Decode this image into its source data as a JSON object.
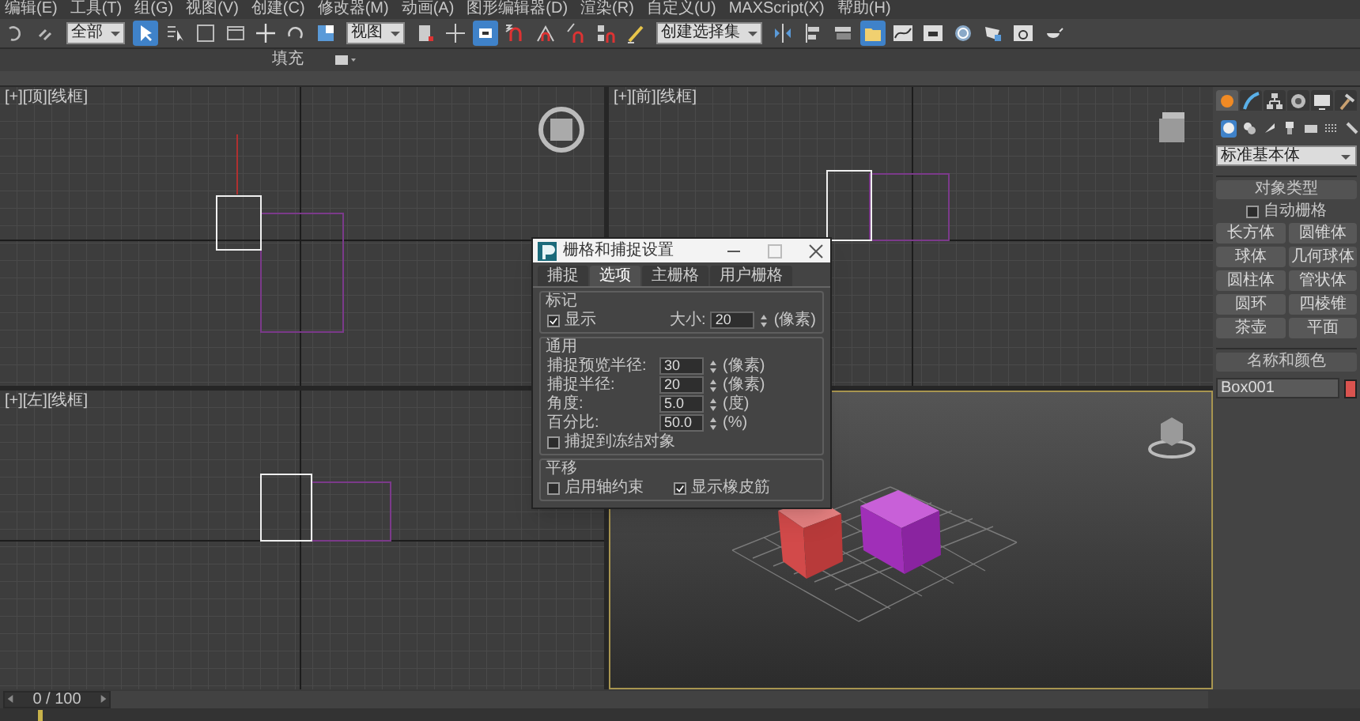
{
  "menu_bar": [
    "编辑(E)",
    "工具(T)",
    "组(G)",
    "视图(V)",
    "创建(C)",
    "修改器(M)",
    "动画(A)",
    "图形编辑器(D)",
    "渲染(R)",
    "自定义(U)",
    "MAXScript(X)",
    "帮助(H)"
  ],
  "toolbar": [
    {
      "kind": "button",
      "selected": false
    },
    {
      "kind": "button",
      "selected": false
    },
    {
      "kind": "dropdown",
      "value": "全部"
    },
    {
      "kind": "button",
      "selected": true
    },
    {
      "kind": "button",
      "selected": false
    },
    {
      "kind": "button",
      "selected": false
    },
    {
      "kind": "button",
      "selected": false
    },
    {
      "kind": "button",
      "selected": false
    },
    {
      "kind": "button",
      "selected": false
    },
    {
      "kind": "button",
      "selected": false
    },
    {
      "kind": "dropdown",
      "value": "视图"
    },
    {
      "kind": "button",
      "selected": false
    },
    {
      "kind": "button",
      "selected": false
    },
    {
      "kind": "button",
      "selected": true
    },
    {
      "kind": "button",
      "selected": false
    },
    {
      "kind": "button",
      "selected": false
    },
    {
      "kind": "button",
      "selected": false
    },
    {
      "kind": "button",
      "selected": false
    },
    {
      "kind": "button",
      "selected": false
    },
    {
      "kind": "dropdown",
      "value": "创建选择集"
    },
    {
      "kind": "button",
      "selected": false
    },
    {
      "kind": "button",
      "selected": false
    },
    {
      "kind": "button",
      "selected": false
    },
    {
      "kind": "button",
      "selected": true
    },
    {
      "kind": "button",
      "selected": false
    },
    {
      "kind": "button",
      "selected": false
    },
    {
      "kind": "button",
      "selected": false
    },
    {
      "kind": "button",
      "selected": false
    },
    {
      "kind": "button",
      "selected": false
    },
    {
      "kind": "button",
      "selected": false
    }
  ],
  "ribbon": {
    "label": "填充"
  },
  "viewports": [
    {
      "label": "[+][顶][线框]",
      "kind": "top"
    },
    {
      "label": "[+][前][线框]",
      "kind": "front"
    },
    {
      "label": "[+][左][线框]",
      "kind": "left"
    },
    {
      "kind": "perspective"
    }
  ],
  "dialog": {
    "title": "栅格和捕捉设置",
    "tabs": [
      {
        "label": "捕捉",
        "selected": false
      },
      {
        "label": "选项",
        "selected": true
      },
      {
        "label": "主栅格",
        "selected": false
      },
      {
        "label": "用户栅格",
        "selected": false
      }
    ],
    "groups": [
      {
        "title": "标记",
        "rows": [
          [
            {
              "kind": "checkbox",
              "label": "显示",
              "checked": true
            },
            {
              "kind": "spinner",
              "label": "大小:",
              "value": "20",
              "unit": "(像素)"
            }
          ]
        ]
      },
      {
        "title": "通用",
        "rows": [
          [
            {
              "kind": "spinner",
              "label": "捕捉预览半径:",
              "value": "30",
              "unit": "(像素)"
            }
          ],
          [
            {
              "kind": "spinner",
              "label": "捕捉半径:",
              "value": "20",
              "unit": "(像素)"
            }
          ],
          [
            {
              "kind": "spinner",
              "label": "角度:",
              "value": "5.0",
              "unit": "(度)"
            }
          ],
          [
            {
              "kind": "spinner",
              "label": "百分比:",
              "value": "50.0",
              "unit": "(%)"
            }
          ],
          [
            {
              "kind": "checkbox",
              "label": "捕捉到冻结对象",
              "checked": false
            }
          ]
        ]
      },
      {
        "title": "平移",
        "rows": [
          [
            {
              "kind": "checkbox",
              "label": "启用轴约束",
              "checked": false
            },
            {
              "kind": "checkbox",
              "label": "显示橡皮筋",
              "checked": true
            }
          ]
        ]
      }
    ]
  },
  "command_panel": {
    "tabs": [
      {
        "selected": true
      },
      {
        "selected": false
      },
      {
        "selected": false
      },
      {
        "selected": false
      },
      {
        "selected": false
      },
      {
        "selected": false
      }
    ],
    "categories": [
      {
        "selected": true
      },
      {
        "selected": false
      },
      {
        "selected": false
      },
      {
        "selected": false
      },
      {
        "selected": false
      },
      {
        "selected": false
      },
      {
        "selected": false
      }
    ],
    "type_dropdown": "标准基本体",
    "object_type": {
      "title": "对象类型",
      "auto_grid": {
        "label": "自动栅格",
        "checked": false
      },
      "buttons": [
        "长方体",
        "圆锥体",
        "球体",
        "几何球体",
        "圆柱体",
        "管状体",
        "圆环",
        "四棱锥",
        "茶壶",
        "平面"
      ]
    },
    "name_and_color": {
      "title": "名称和颜色",
      "name": "Box001",
      "color": "#d9534f"
    }
  },
  "time_slider": {
    "label": "0 / 100",
    "level": 0
  }
}
